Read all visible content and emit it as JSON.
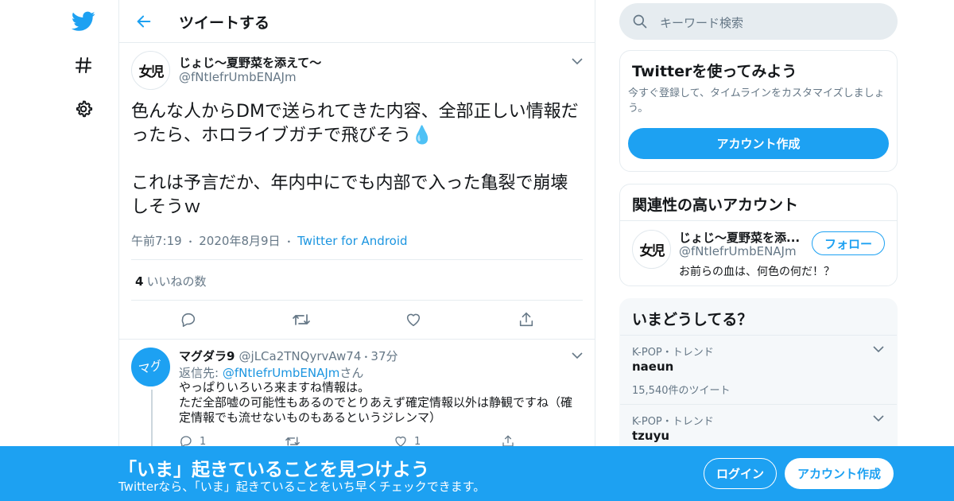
{
  "header": {
    "title": "ツイートする"
  },
  "tweet": {
    "author_name": "じょじ～夏野菜を添えて～",
    "author_handle": "@fNtIefrUmbENAJm",
    "avatar_text": "女児",
    "text": "色んな人からDMで送られてきた内容、全部正しい情報だったら、ホロライブガチで飛びそう💧\n\nこれは予言だか、年内中にでも内部で入った亀裂で崩壊しそうｗ",
    "time": "午前7:19",
    "date": "2020年8月9日",
    "source": "Twitter for Android",
    "separator": "・",
    "like_count": "4",
    "like_label": "いいねの数"
  },
  "reply": {
    "author_name": "マグダラ9",
    "author_handle": "@jLCa2TNQyrvAw74",
    "time": "37分",
    "avatar_text": "マグ",
    "reply_prefix": "返信先: ",
    "reply_to": "@fNtIefrUmbENAJm",
    "reply_suffix": "さん",
    "text": "やっぱりいろいろ来ますね情報は。\nただ全部嘘の可能性もあるのでとりあえず確定情報以外は静観ですね（確定情報でも流せないものもあるというジレンマ）",
    "reply_count": "1",
    "like_count": "1"
  },
  "search": {
    "placeholder": "キーワード検索"
  },
  "signup_card": {
    "title": "Twitterを使ってみよう",
    "desc": "今すぐ登録して、タイムラインをカスタマイズしましょう。",
    "button": "アカウント作成"
  },
  "related_card": {
    "title": "関連性の高いアカウント",
    "name": "じょじ～夏野菜を添...",
    "handle": "@fNtIefrUmbENAJm",
    "bio": "お前らの血は、何色の何だ！？",
    "follow_label": "フォロー"
  },
  "trends_card": {
    "title": "いまどうしてる？",
    "items": [
      {
        "category": "K-POP・トレンド",
        "name": "naeun",
        "count": "15,540件のツイート"
      },
      {
        "category": "K-POP・トレンド",
        "name": "tzuyu",
        "count": ""
      }
    ]
  },
  "banner": {
    "title": "「いま」起きていることを見つけよう",
    "subtitle": "Twitterなら、「いま」起きていることをいち早くチェックできます。",
    "login_label": "ログイン",
    "signup_label": "アカウント作成"
  },
  "colors": {
    "accent": "#1da1f2",
    "text": "#14171a",
    "muted": "#657786",
    "border": "#e6ecf0"
  }
}
